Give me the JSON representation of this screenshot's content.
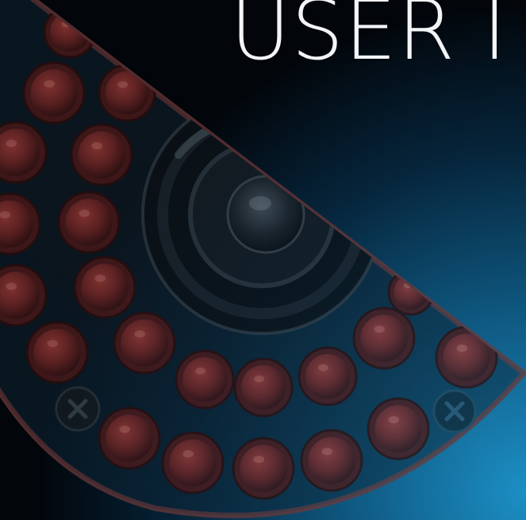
{
  "header": {
    "title": "USER I"
  },
  "colors": {
    "background_dark": "#020509",
    "background_glow": "#1c8fc4",
    "led_red": "#7a2d2c",
    "housing_outline": "#6b3838",
    "title_text": "#f2f4f6"
  },
  "illustration": {
    "subject": "camera-module-with-infrared-leds",
    "icons": [
      "camera-lens-icon",
      "led-icon",
      "screw-icon"
    ]
  }
}
